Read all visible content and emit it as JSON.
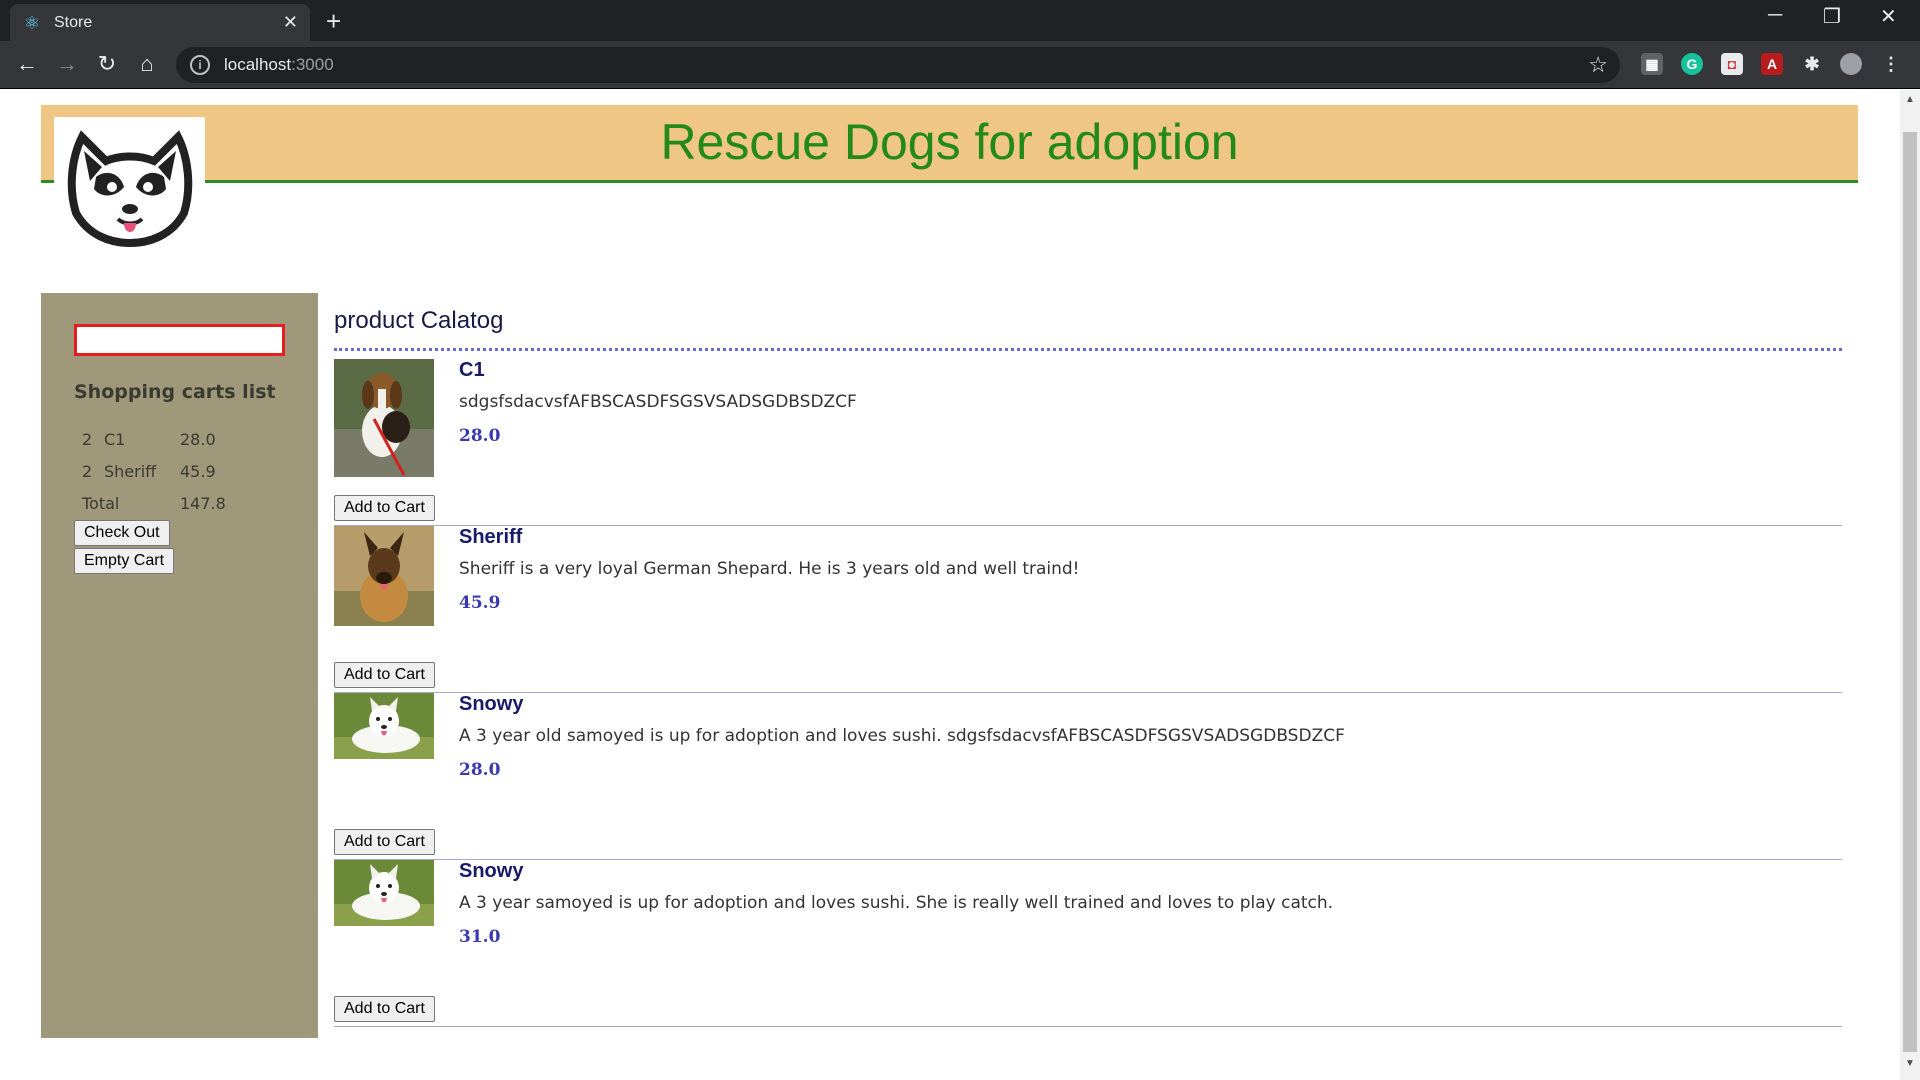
{
  "browser": {
    "tab_title": "Store",
    "url_host": "localhost",
    "url_port": ":3000"
  },
  "header": {
    "title": "Rescue Dogs for adoption"
  },
  "sidebar": {
    "search_value": "",
    "cart_title": "Shopping carts list",
    "cart_items": [
      {
        "qty": "2",
        "name": "C1",
        "price": "28.0"
      },
      {
        "qty": "2",
        "name": "Sheriff",
        "price": "45.9"
      }
    ],
    "total_label": "Total",
    "total_value": "147.8",
    "checkout_label": "Check Out",
    "empty_label": "Empty Cart"
  },
  "catalog": {
    "title": "product Calatog",
    "add_label": "Add to Cart",
    "products": [
      {
        "name": "C1",
        "desc": "sdgsfsdacvsfAFBSCASDFSGSVSADSGDBSDZCF",
        "price": "28.0",
        "image": "beagle-photo"
      },
      {
        "name": "Sheriff",
        "desc": "Sheriff is a very loyal German Shepard. He is 3 years old and well traind!",
        "price": "45.9",
        "image": "german-shepherd-photo"
      },
      {
        "name": "Snowy",
        "desc": "A 3 year old samoyed is up for adoption and loves sushi. sdgsfsdacvsfAFBSCASDFSGSVSADSGDBSDZCF",
        "price": "28.0",
        "image": "samoyed-photo"
      },
      {
        "name": "Snowy",
        "desc": "A 3 year samoyed is up for adoption and loves sushi. She is really well trained and loves to play catch.",
        "price": "31.0",
        "image": "samoyed-photo"
      }
    ]
  },
  "colors": {
    "header_bg": "#efc684",
    "header_text": "#23891a",
    "sidebar_bg": "#a0987a",
    "search_border": "#e81d1d"
  }
}
